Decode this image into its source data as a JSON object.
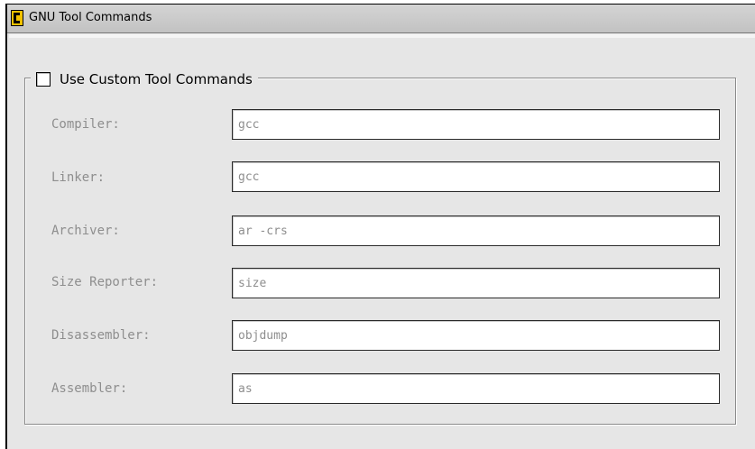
{
  "window": {
    "title": "GNU Tool Commands",
    "icon": "gnu-app-icon"
  },
  "group": {
    "checkbox_label": "Use Custom Tool Commands",
    "checked": false
  },
  "fields": {
    "compiler": {
      "label": "Compiler:",
      "value": "gcc"
    },
    "linker": {
      "label": "Linker:",
      "value": "gcc"
    },
    "archiver": {
      "label": "Archiver:",
      "value": "ar -crs"
    },
    "size_reporter": {
      "label": "Size Reporter:",
      "value": "size"
    },
    "disassembler": {
      "label": "Disassembler:",
      "value": "objdump"
    },
    "assembler": {
      "label": "Assembler:",
      "value": "as"
    }
  },
  "colors": {
    "panel_background": "#e6e6e6",
    "disabled_text": "#8e8e8e",
    "icon_yellow": "#f2c200"
  }
}
